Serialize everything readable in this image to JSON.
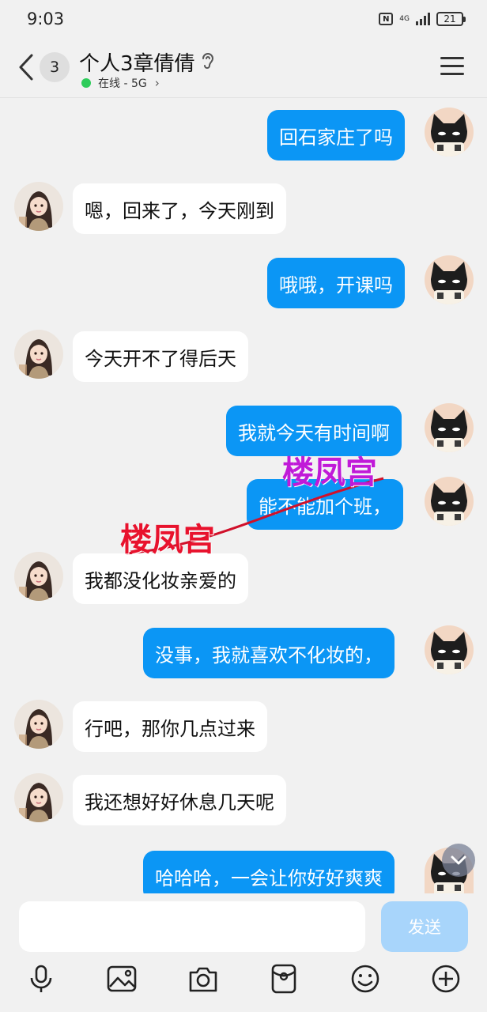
{
  "status_bar": {
    "time": "9:03",
    "nfc_label": "N",
    "network_label": "4G",
    "battery_level": "21"
  },
  "header": {
    "unread_count": "3",
    "title": "个人3章倩倩",
    "presence": "在线 - 5G",
    "presence_chevron": "›"
  },
  "messages": [
    {
      "side": "out",
      "text": "回石家庄了吗"
    },
    {
      "side": "in",
      "text": "嗯，回来了，今天刚到"
    },
    {
      "side": "out",
      "text": "哦哦，开课吗"
    },
    {
      "side": "in",
      "text": "今天开不了得后天"
    },
    {
      "side": "out",
      "text": "我就今天有时间啊"
    },
    {
      "side": "out",
      "text": "能不能加个班，"
    },
    {
      "side": "in",
      "text": "我都没化妆亲爱的"
    },
    {
      "side": "out",
      "text": "没事，我就喜欢不化妆的，"
    },
    {
      "side": "in",
      "text": "行吧，那你几点过来"
    },
    {
      "side": "in",
      "text": "我还想好好休息几天呢"
    },
    {
      "side": "out",
      "text": "哈哈哈，一会让你好好爽爽"
    }
  ],
  "watermarks": [
    "楼凤宫",
    "楼凤宫"
  ],
  "input": {
    "value": "",
    "send_label": "发送"
  },
  "toolbar": {
    "icons": [
      "microphone-icon",
      "image-icon",
      "camera-icon",
      "red-packet-icon",
      "emoji-icon",
      "plus-icon"
    ]
  },
  "colors": {
    "outgoing_bubble": "#0b96f5",
    "incoming_bubble": "#ffffff",
    "background": "#f1f1f1",
    "send_button": "#a8d5fb",
    "online_dot": "#2ecc5a"
  }
}
